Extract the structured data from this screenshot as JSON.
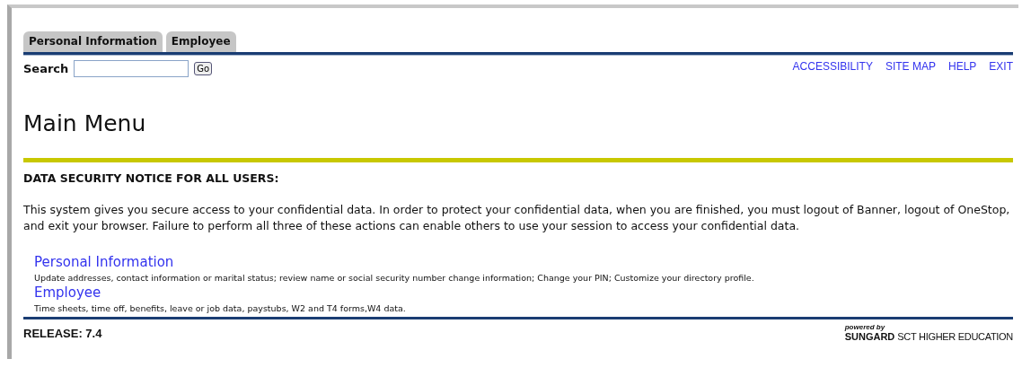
{
  "tabs": [
    {
      "label": "Personal Information",
      "selected": false
    },
    {
      "label": "Employee",
      "selected": false
    }
  ],
  "search": {
    "label": "Search",
    "button": "Go"
  },
  "top_links": [
    "ACCESSIBILITY",
    "SITE MAP",
    "HELP",
    "EXIT"
  ],
  "title": "Main Menu",
  "notice": {
    "heading": "DATA SECURITY NOTICE FOR ALL USERS:",
    "text": "This system gives you secure access to your confidential data. In order to protect your confidential data, when you are finished, you must logout of Banner, logout of OneStop, and exit your browser. Failure to perform all three of these actions can enable others to use your session to access your confidential data."
  },
  "menu": [
    {
      "link": "Personal Information",
      "description": "Update addresses, contact information or marital status; review name or social security number change information; Change your PIN; Customize your directory profile."
    },
    {
      "link": "Employee",
      "description": "Time sheets, time off, benefits, leave or job data, paystubs, W2 and T4 forms,W4 data."
    }
  ],
  "footer": {
    "release": "RELEASE: 7.4",
    "powered_by": "powered by",
    "brand": "SUNGARD",
    "brand_suffix": "SCT HIGHER EDUCATION"
  }
}
